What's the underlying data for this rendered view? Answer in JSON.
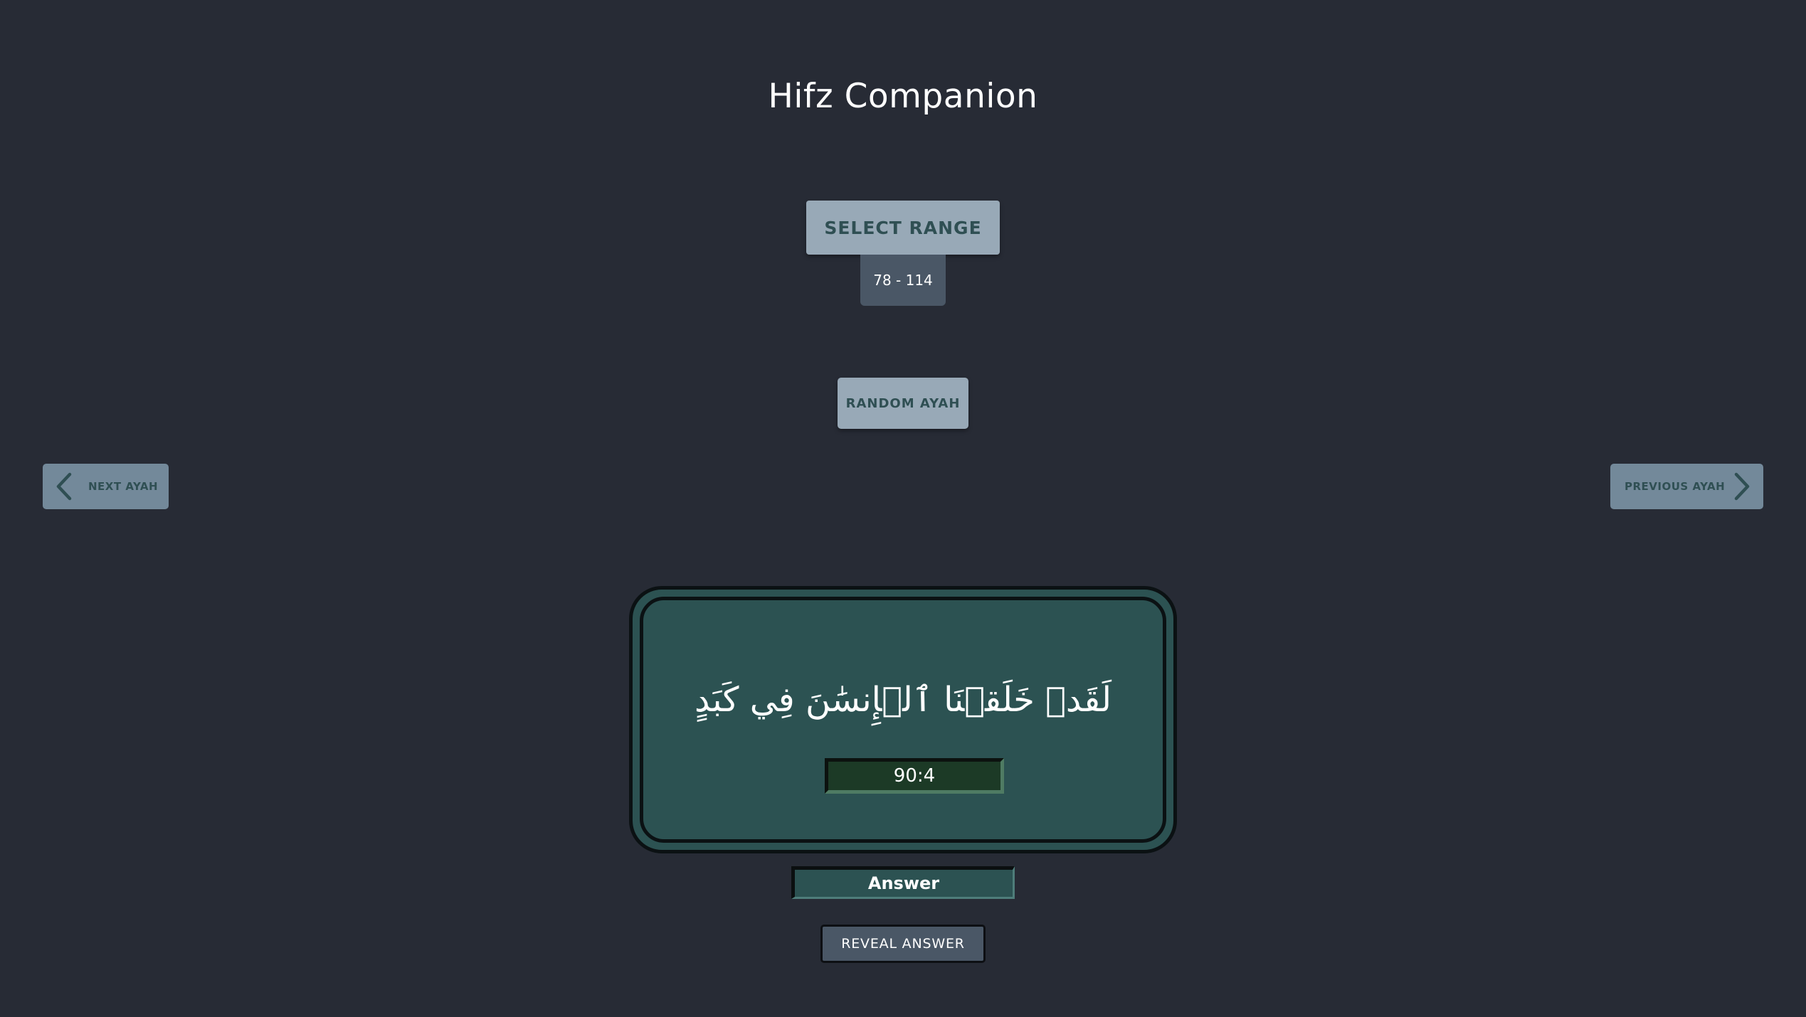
{
  "app": {
    "title": "Hifz Companion"
  },
  "controls": {
    "select_range_label": "SELECT RANGE",
    "range_value": "78 - 114",
    "random_label": "RANDOM AYAH",
    "next_label": "NEXT AYAH",
    "previous_label": "PREVIOUS AYAH",
    "next_icon": "chevron-left-icon",
    "previous_icon": "chevron-right-icon"
  },
  "card": {
    "ayah_text": "لَقَدۡ خَلَقۡنَا ٱلۡإِنسَٰنَ فِي كَبَدٍ",
    "reference": "90:4"
  },
  "answer": {
    "placeholder": "Answer",
    "value": "",
    "reveal_label": "REVEAL ANSWER"
  },
  "colors": {
    "background": "#272b35",
    "button_light": "#98a9b7",
    "button_text": "#2f4f53",
    "card": "#2c5252",
    "reference_box": "#1c3a26",
    "reveal_button": "#4a5766"
  }
}
